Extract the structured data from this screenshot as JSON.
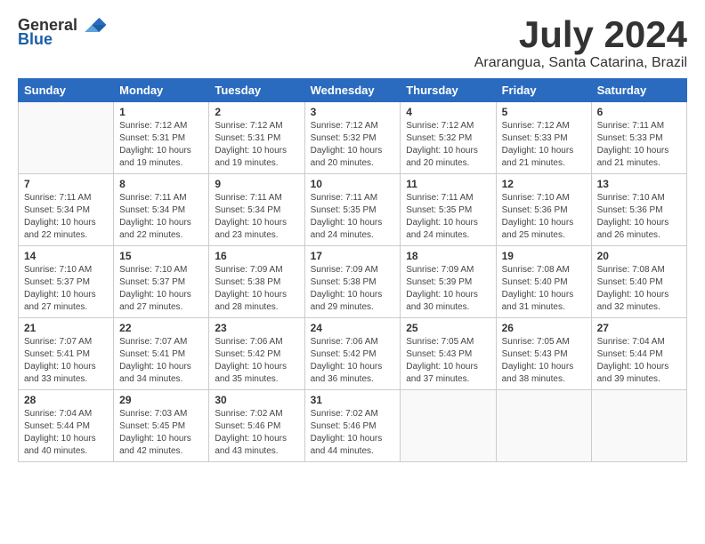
{
  "header": {
    "logo_general": "General",
    "logo_blue": "Blue",
    "month": "July 2024",
    "location": "Ararangua, Santa Catarina, Brazil"
  },
  "weekdays": [
    "Sunday",
    "Monday",
    "Tuesday",
    "Wednesday",
    "Thursday",
    "Friday",
    "Saturday"
  ],
  "weeks": [
    [
      {
        "day": "",
        "info": ""
      },
      {
        "day": "1",
        "info": "Sunrise: 7:12 AM\nSunset: 5:31 PM\nDaylight: 10 hours\nand 19 minutes."
      },
      {
        "day": "2",
        "info": "Sunrise: 7:12 AM\nSunset: 5:31 PM\nDaylight: 10 hours\nand 19 minutes."
      },
      {
        "day": "3",
        "info": "Sunrise: 7:12 AM\nSunset: 5:32 PM\nDaylight: 10 hours\nand 20 minutes."
      },
      {
        "day": "4",
        "info": "Sunrise: 7:12 AM\nSunset: 5:32 PM\nDaylight: 10 hours\nand 20 minutes."
      },
      {
        "day": "5",
        "info": "Sunrise: 7:12 AM\nSunset: 5:33 PM\nDaylight: 10 hours\nand 21 minutes."
      },
      {
        "day": "6",
        "info": "Sunrise: 7:11 AM\nSunset: 5:33 PM\nDaylight: 10 hours\nand 21 minutes."
      }
    ],
    [
      {
        "day": "7",
        "info": "Sunrise: 7:11 AM\nSunset: 5:34 PM\nDaylight: 10 hours\nand 22 minutes."
      },
      {
        "day": "8",
        "info": "Sunrise: 7:11 AM\nSunset: 5:34 PM\nDaylight: 10 hours\nand 22 minutes."
      },
      {
        "day": "9",
        "info": "Sunrise: 7:11 AM\nSunset: 5:34 PM\nDaylight: 10 hours\nand 23 minutes."
      },
      {
        "day": "10",
        "info": "Sunrise: 7:11 AM\nSunset: 5:35 PM\nDaylight: 10 hours\nand 24 minutes."
      },
      {
        "day": "11",
        "info": "Sunrise: 7:11 AM\nSunset: 5:35 PM\nDaylight: 10 hours\nand 24 minutes."
      },
      {
        "day": "12",
        "info": "Sunrise: 7:10 AM\nSunset: 5:36 PM\nDaylight: 10 hours\nand 25 minutes."
      },
      {
        "day": "13",
        "info": "Sunrise: 7:10 AM\nSunset: 5:36 PM\nDaylight: 10 hours\nand 26 minutes."
      }
    ],
    [
      {
        "day": "14",
        "info": "Sunrise: 7:10 AM\nSunset: 5:37 PM\nDaylight: 10 hours\nand 27 minutes."
      },
      {
        "day": "15",
        "info": "Sunrise: 7:10 AM\nSunset: 5:37 PM\nDaylight: 10 hours\nand 27 minutes."
      },
      {
        "day": "16",
        "info": "Sunrise: 7:09 AM\nSunset: 5:38 PM\nDaylight: 10 hours\nand 28 minutes."
      },
      {
        "day": "17",
        "info": "Sunrise: 7:09 AM\nSunset: 5:38 PM\nDaylight: 10 hours\nand 29 minutes."
      },
      {
        "day": "18",
        "info": "Sunrise: 7:09 AM\nSunset: 5:39 PM\nDaylight: 10 hours\nand 30 minutes."
      },
      {
        "day": "19",
        "info": "Sunrise: 7:08 AM\nSunset: 5:40 PM\nDaylight: 10 hours\nand 31 minutes."
      },
      {
        "day": "20",
        "info": "Sunrise: 7:08 AM\nSunset: 5:40 PM\nDaylight: 10 hours\nand 32 minutes."
      }
    ],
    [
      {
        "day": "21",
        "info": "Sunrise: 7:07 AM\nSunset: 5:41 PM\nDaylight: 10 hours\nand 33 minutes."
      },
      {
        "day": "22",
        "info": "Sunrise: 7:07 AM\nSunset: 5:41 PM\nDaylight: 10 hours\nand 34 minutes."
      },
      {
        "day": "23",
        "info": "Sunrise: 7:06 AM\nSunset: 5:42 PM\nDaylight: 10 hours\nand 35 minutes."
      },
      {
        "day": "24",
        "info": "Sunrise: 7:06 AM\nSunset: 5:42 PM\nDaylight: 10 hours\nand 36 minutes."
      },
      {
        "day": "25",
        "info": "Sunrise: 7:05 AM\nSunset: 5:43 PM\nDaylight: 10 hours\nand 37 minutes."
      },
      {
        "day": "26",
        "info": "Sunrise: 7:05 AM\nSunset: 5:43 PM\nDaylight: 10 hours\nand 38 minutes."
      },
      {
        "day": "27",
        "info": "Sunrise: 7:04 AM\nSunset: 5:44 PM\nDaylight: 10 hours\nand 39 minutes."
      }
    ],
    [
      {
        "day": "28",
        "info": "Sunrise: 7:04 AM\nSunset: 5:44 PM\nDaylight: 10 hours\nand 40 minutes."
      },
      {
        "day": "29",
        "info": "Sunrise: 7:03 AM\nSunset: 5:45 PM\nDaylight: 10 hours\nand 42 minutes."
      },
      {
        "day": "30",
        "info": "Sunrise: 7:02 AM\nSunset: 5:46 PM\nDaylight: 10 hours\nand 43 minutes."
      },
      {
        "day": "31",
        "info": "Sunrise: 7:02 AM\nSunset: 5:46 PM\nDaylight: 10 hours\nand 44 minutes."
      },
      {
        "day": "",
        "info": ""
      },
      {
        "day": "",
        "info": ""
      },
      {
        "day": "",
        "info": ""
      }
    ]
  ]
}
